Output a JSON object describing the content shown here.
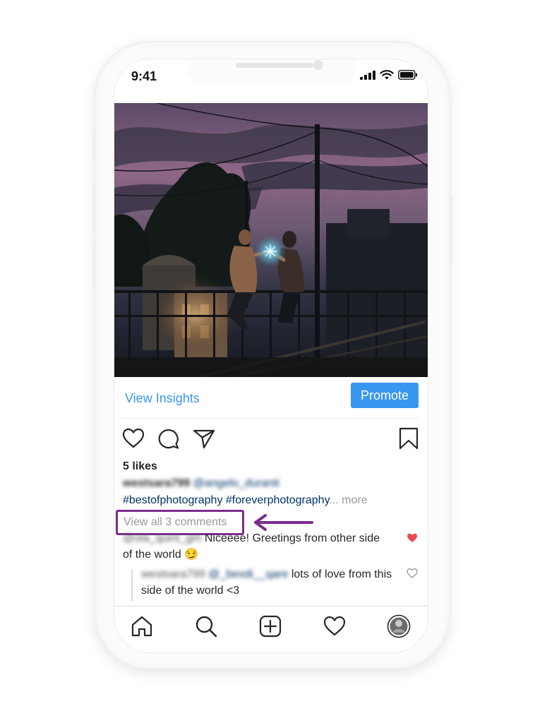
{
  "status_bar": {
    "time": "9:41"
  },
  "post": {
    "view_insights": "View Insights",
    "promote": "Promote",
    "likes": "5 likes",
    "caption": {
      "username": "westsara799",
      "mention": "@angelo_duranti",
      "hashtag_1": "#bestofphotography",
      "hashtag_2": "#foreverphotography",
      "ellipsis": "...",
      "more": "more"
    },
    "view_all_comments": "View all 3 comments",
    "comments": [
      {
        "username": "@ola_quinl_gm",
        "text": "Niceeee! Greetings from other side of the world 😏"
      },
      {
        "username": "westsara799",
        "mention": "@_bexdi__qare",
        "text": "lots of love from this side of the world <3"
      }
    ]
  },
  "colors": {
    "link_blue": "#3897f0",
    "highlight_purple": "#7b2d8e",
    "heart_red": "#ed4956"
  },
  "icons": [
    "heart-icon",
    "comment-icon",
    "share-icon",
    "bookmark-icon",
    "home-icon",
    "search-icon",
    "add-post-icon",
    "activity-icon",
    "profile-avatar"
  ]
}
